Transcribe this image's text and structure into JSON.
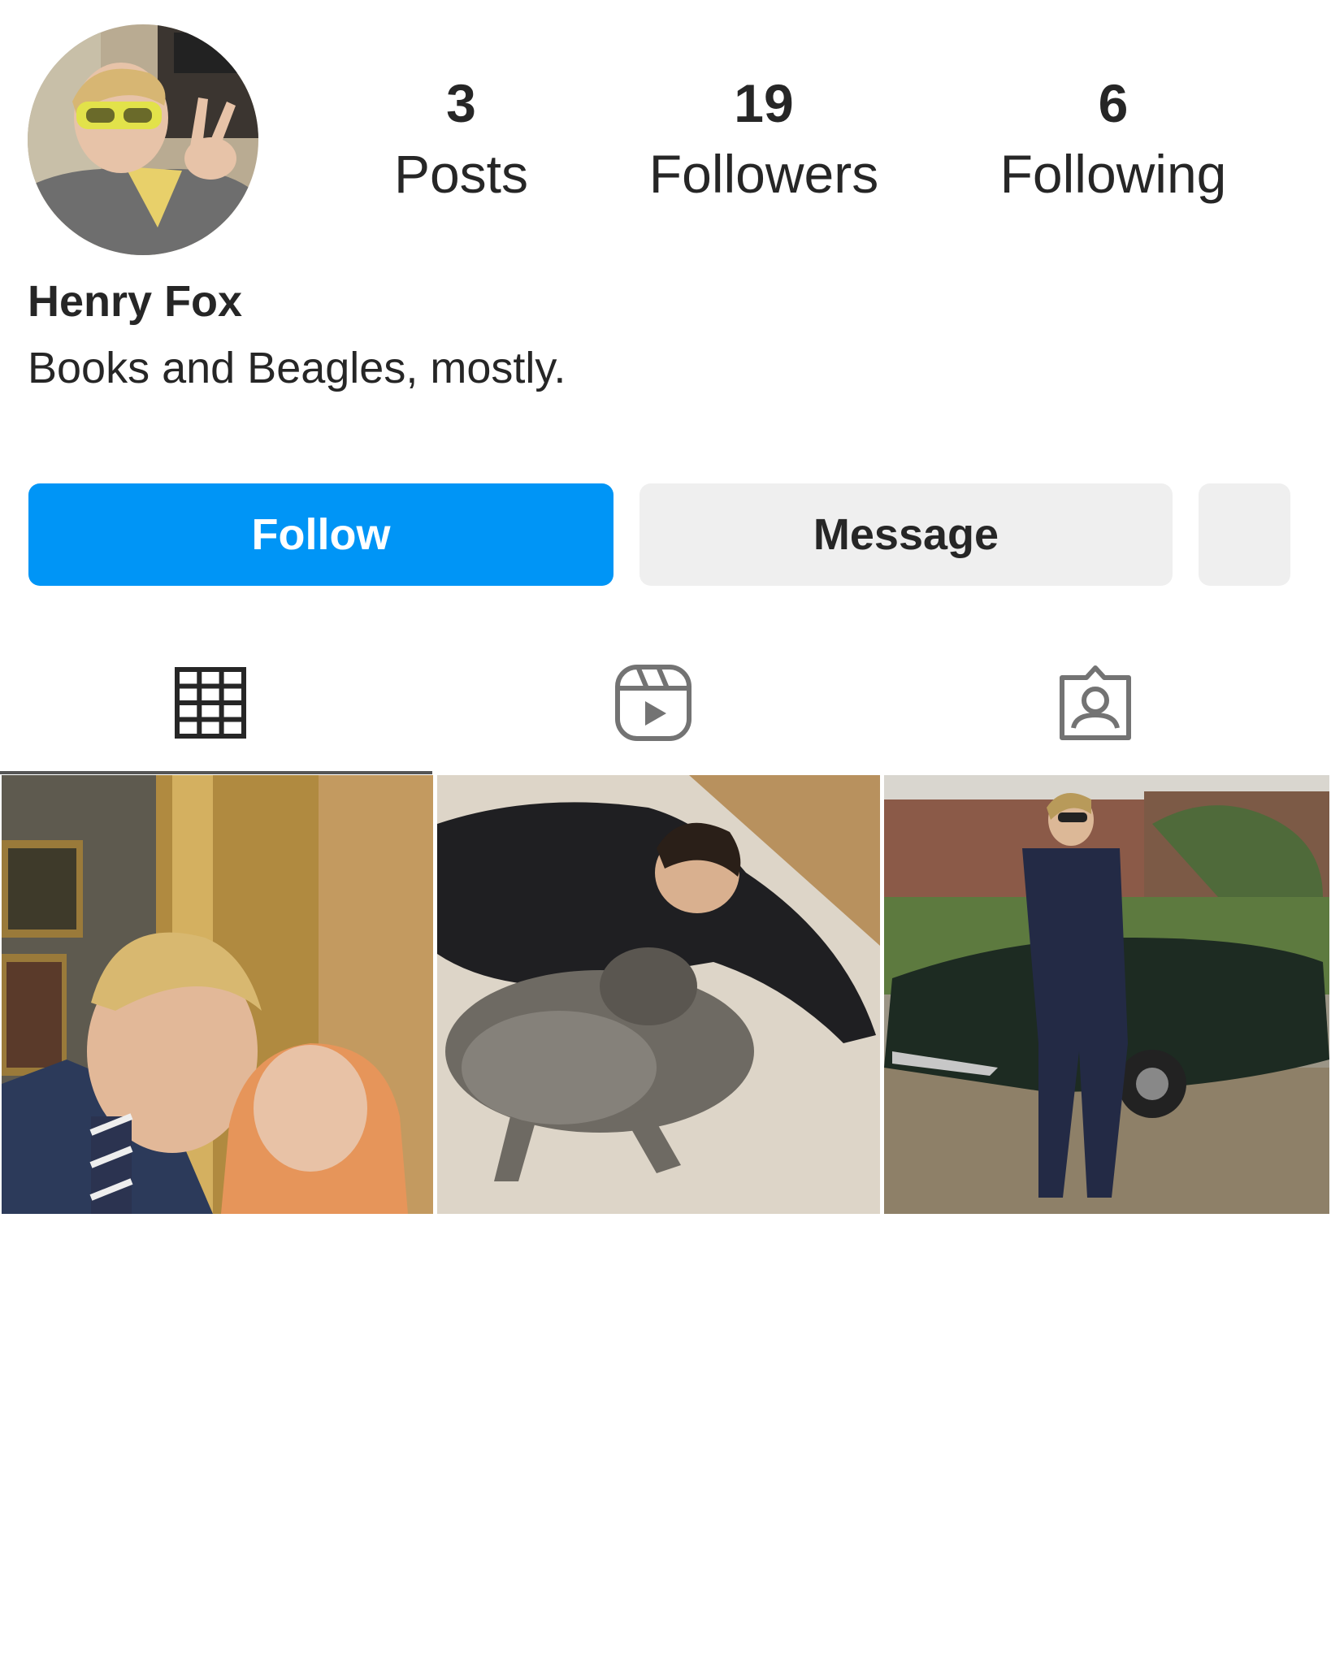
{
  "profile": {
    "name": "Henry Fox",
    "bio": "Books and Beagles, mostly."
  },
  "stats": {
    "posts": {
      "count": "3",
      "label": "Posts"
    },
    "followers": {
      "count": "19",
      "label": "Followers"
    },
    "following": {
      "count": "6",
      "label": "Following"
    }
  },
  "actions": {
    "follow_label": "Follow",
    "message_label": "Message"
  },
  "tabs": [
    {
      "icon": "grid-icon",
      "active": true
    },
    {
      "icon": "reels-icon",
      "active": false
    },
    {
      "icon": "tagged-icon",
      "active": false
    }
  ],
  "colors": {
    "primary_button": "#0095f6",
    "secondary_button": "#efefef",
    "text": "#262626"
  },
  "posts": [
    {
      "description_icon": "photo-thumbnail"
    },
    {
      "description_icon": "photo-thumbnail"
    },
    {
      "description_icon": "photo-thumbnail"
    }
  ]
}
